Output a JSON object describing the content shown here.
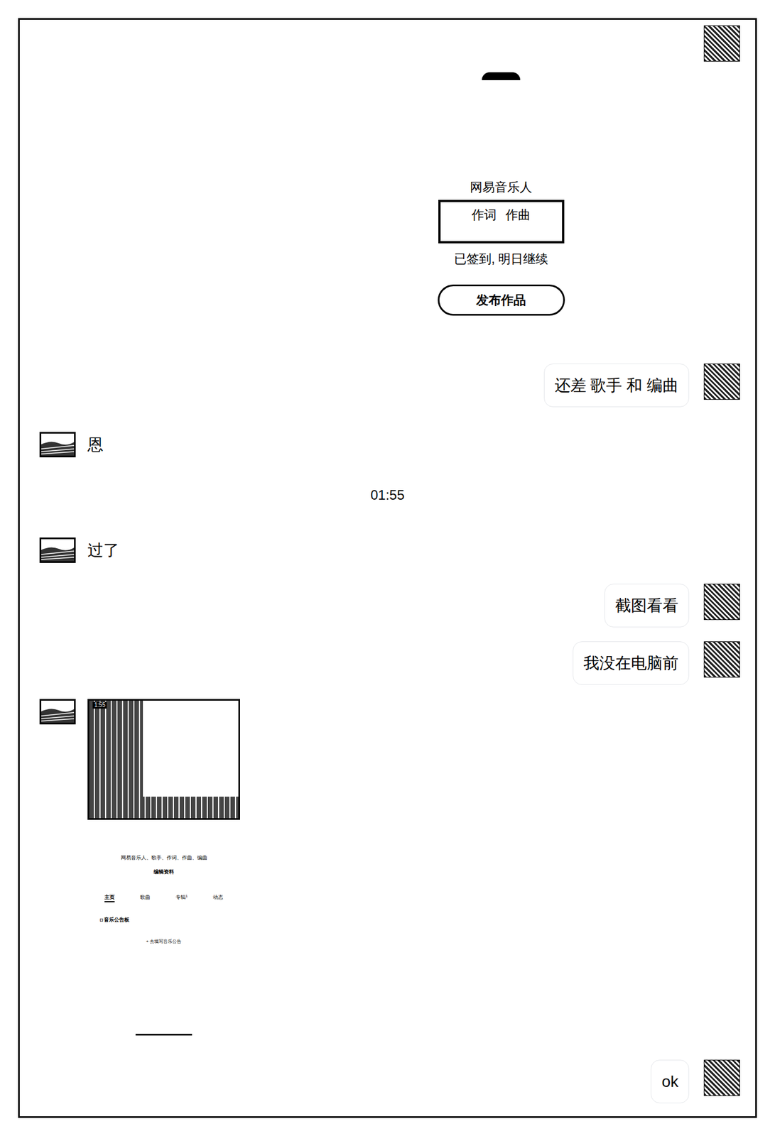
{
  "messages": [
    {
      "kind": "profile-image",
      "from": "me",
      "title": "网易音乐人",
      "roles": [
        "作词",
        "作曲"
      ],
      "signin": "已签到, 明日继续",
      "button": "发布作品"
    },
    {
      "kind": "text",
      "from": "me",
      "text": "还差 歌手 和 编曲"
    },
    {
      "kind": "text",
      "from": "them",
      "text": "恩"
    },
    {
      "kind": "time",
      "from": "system",
      "text": "01:55"
    },
    {
      "kind": "text",
      "from": "them",
      "text": "过了"
    },
    {
      "kind": "text",
      "from": "me",
      "text": "截图看看"
    },
    {
      "kind": "text",
      "from": "me",
      "text": "我没在电脑前"
    },
    {
      "kind": "screenshot-image",
      "from": "them",
      "status_time": "1:55",
      "tags": "网易音乐人、歌手、作词、作曲、编曲",
      "edit": "编辑资料",
      "tabs": [
        {
          "label": "主页",
          "count": "",
          "selected": true
        },
        {
          "label": "歌曲",
          "count": "",
          "selected": false
        },
        {
          "label": "专辑",
          "count": "1",
          "selected": false
        },
        {
          "label": "动态",
          "count": "",
          "selected": false
        }
      ],
      "board": "音乐公告板",
      "board_icon": "◘",
      "add": "+ 去填写音乐公告"
    },
    {
      "kind": "text",
      "from": "me",
      "text": "ok"
    }
  ]
}
